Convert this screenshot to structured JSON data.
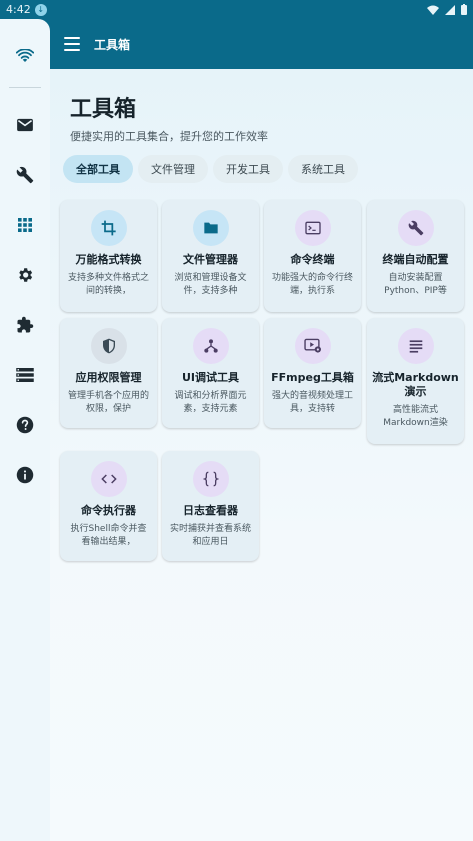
{
  "status_bar": {
    "time": "4:42",
    "notif_icon": "download-icon",
    "icons": [
      "wifi-icon",
      "signal-icon",
      "battery-icon"
    ]
  },
  "app_bar": {
    "title": "工具箱",
    "menu_icon": "menu-icon"
  },
  "rail": {
    "items": [
      {
        "icon": "wifi-icon"
      },
      {
        "icon": "mail-icon"
      },
      {
        "icon": "wrench-icon"
      },
      {
        "icon": "apps-grid-icon",
        "selected": true
      },
      {
        "icon": "settings-icon"
      },
      {
        "icon": "extension-icon"
      },
      {
        "icon": "storage-list-icon"
      },
      {
        "icon": "help-icon"
      },
      {
        "icon": "info-icon"
      }
    ]
  },
  "page": {
    "title": "工具箱",
    "subtitle": "便捷实用的工具集合，提升您的工作效率"
  },
  "tabs": [
    {
      "label": "全部工具",
      "active": true
    },
    {
      "label": "文件管理",
      "active": false
    },
    {
      "label": "开发工具",
      "active": false
    },
    {
      "label": "系统工具",
      "active": false
    }
  ],
  "tools": [
    {
      "name": "万能格式转换",
      "desc": "支持多种文件格式之间的转换，",
      "icon": "crop-icon",
      "tint": "blue"
    },
    {
      "name": "文件管理器",
      "desc": "浏览和管理设备文件，支持多种",
      "icon": "folder-icon",
      "tint": "blue"
    },
    {
      "name": "命令终端",
      "desc": "功能强大的命令行终端，执行系",
      "icon": "terminal-icon",
      "tint": "purple"
    },
    {
      "name": "终端自动配置",
      "desc": "自动安装配置Python、PIP等",
      "icon": "wrench-icon",
      "tint": "purple"
    },
    {
      "name": "应用权限管理",
      "desc": "管理手机各个应用的权限，保护",
      "icon": "shield-icon",
      "tint": "slate"
    },
    {
      "name": "UI调试工具",
      "desc": "调试和分析界面元素，支持元素",
      "icon": "hierarchy-icon",
      "tint": "purple"
    },
    {
      "name": "FFmpeg工具箱",
      "desc": "强大的音视频处理工具，支持转",
      "icon": "video-settings-icon",
      "tint": "purple"
    },
    {
      "name": "流式Markdown演示",
      "desc": "高性能流式Markdown渲染",
      "icon": "text-lines-icon",
      "tint": "purple"
    },
    {
      "name": "命令执行器",
      "desc": "执行Shell命令并查看输出结果，",
      "icon": "code-icon",
      "tint": "purple"
    },
    {
      "name": "日志查看器",
      "desc": "实时捕获并查看系统和应用日",
      "icon": "braces-icon",
      "tint": "purple"
    }
  ]
}
